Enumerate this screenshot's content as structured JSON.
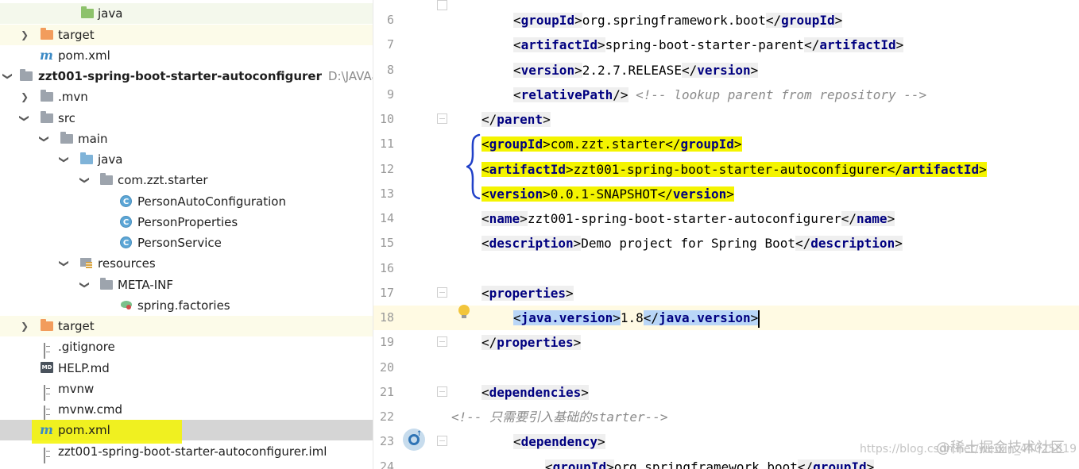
{
  "tree": {
    "items": [
      {
        "label": "java",
        "icon": "folder-green-icon"
      },
      {
        "label": "target",
        "icon": "folder-orange-icon"
      },
      {
        "label": "pom.xml",
        "icon": "maven-icon"
      },
      {
        "label": "zzt001-spring-boot-starter-autoconfigurer",
        "path": "D:\\JAVAall\\S|",
        "icon": "module-folder-icon"
      },
      {
        "label": ".mvn",
        "icon": "folder-icon"
      },
      {
        "label": "src",
        "icon": "folder-icon"
      },
      {
        "label": "main",
        "icon": "folder-icon"
      },
      {
        "label": "java",
        "icon": "folder-blue-icon"
      },
      {
        "label": "com.zzt.starter",
        "icon": "package-icon"
      },
      {
        "label": "PersonAutoConfiguration",
        "icon": "class-icon"
      },
      {
        "label": "PersonProperties",
        "icon": "class-icon"
      },
      {
        "label": "PersonService",
        "icon": "class-icon"
      },
      {
        "label": "resources",
        "icon": "resources-folder-icon"
      },
      {
        "label": "META-INF",
        "icon": "folder-icon"
      },
      {
        "label": "spring.factories",
        "icon": "spring-file-icon"
      },
      {
        "label": "target",
        "icon": "folder-orange-icon"
      },
      {
        "label": ".gitignore",
        "icon": "text-file-icon"
      },
      {
        "label": "HELP.md",
        "icon": "markdown-file-icon"
      },
      {
        "label": "mvnw",
        "icon": "text-file-icon"
      },
      {
        "label": "mvnw.cmd",
        "icon": "text-file-icon"
      },
      {
        "label": "pom.xml",
        "icon": "maven-icon"
      },
      {
        "label": "zzt001-spring-boot-starter-autoconfigurer.iml",
        "icon": "iml-file-icon"
      }
    ],
    "class_letter": "C",
    "md_badge": "MD",
    "maven_letter": "m"
  },
  "editor": {
    "line_numbers": [
      "6",
      "7",
      "8",
      "9",
      "10",
      "11",
      "12",
      "13",
      "14",
      "15",
      "16",
      "17",
      "18",
      "19",
      "20",
      "21",
      "22",
      "23",
      "24"
    ],
    "lines": {
      "l6": {
        "tag": "groupId",
        "value": "org.springframework.boot"
      },
      "l7": {
        "tag": "artifactId",
        "value": "spring-boot-starter-parent"
      },
      "l8": {
        "tag": "version",
        "value": "2.2.7.RELEASE"
      },
      "l9": {
        "tag": "relativePath",
        "comment": "<!-- lookup parent from repository -->"
      },
      "l10": {
        "tag": "parent"
      },
      "l11": {
        "tag": "groupId",
        "value": "com.zzt.starter"
      },
      "l12": {
        "tag": "artifactId",
        "value": "zzt001-spring-boot-starter-autoconfigurer"
      },
      "l13": {
        "tag": "version",
        "value": "0.0.1-SNAPSHOT"
      },
      "l14": {
        "tag": "name",
        "value": "zzt001-spring-boot-starter-autoconfigurer"
      },
      "l15": {
        "tag": "description",
        "value": "Demo project for Spring Boot"
      },
      "l17": {
        "tag": "properties"
      },
      "l18": {
        "tag": "java.version",
        "value": "1.8"
      },
      "l19": {
        "tag": "properties"
      },
      "l21": {
        "tag": "dependencies"
      },
      "l22": {
        "comment": "<!-- 只需要引入基础的starter-->"
      },
      "l23": {
        "tag": "dependency"
      },
      "l24": {
        "tag": "groupId",
        "value": "org.springframework.boot"
      }
    }
  },
  "watermark": {
    "url": "https://blog.csdn.net/weixin_44025819",
    "site": "@稀土掘金技术社区"
  },
  "colors": {
    "tag": "#000080",
    "highlight_yellow": "#f4f400",
    "selection_blue": "#b9d6f7",
    "current_line": "#fffae3"
  }
}
